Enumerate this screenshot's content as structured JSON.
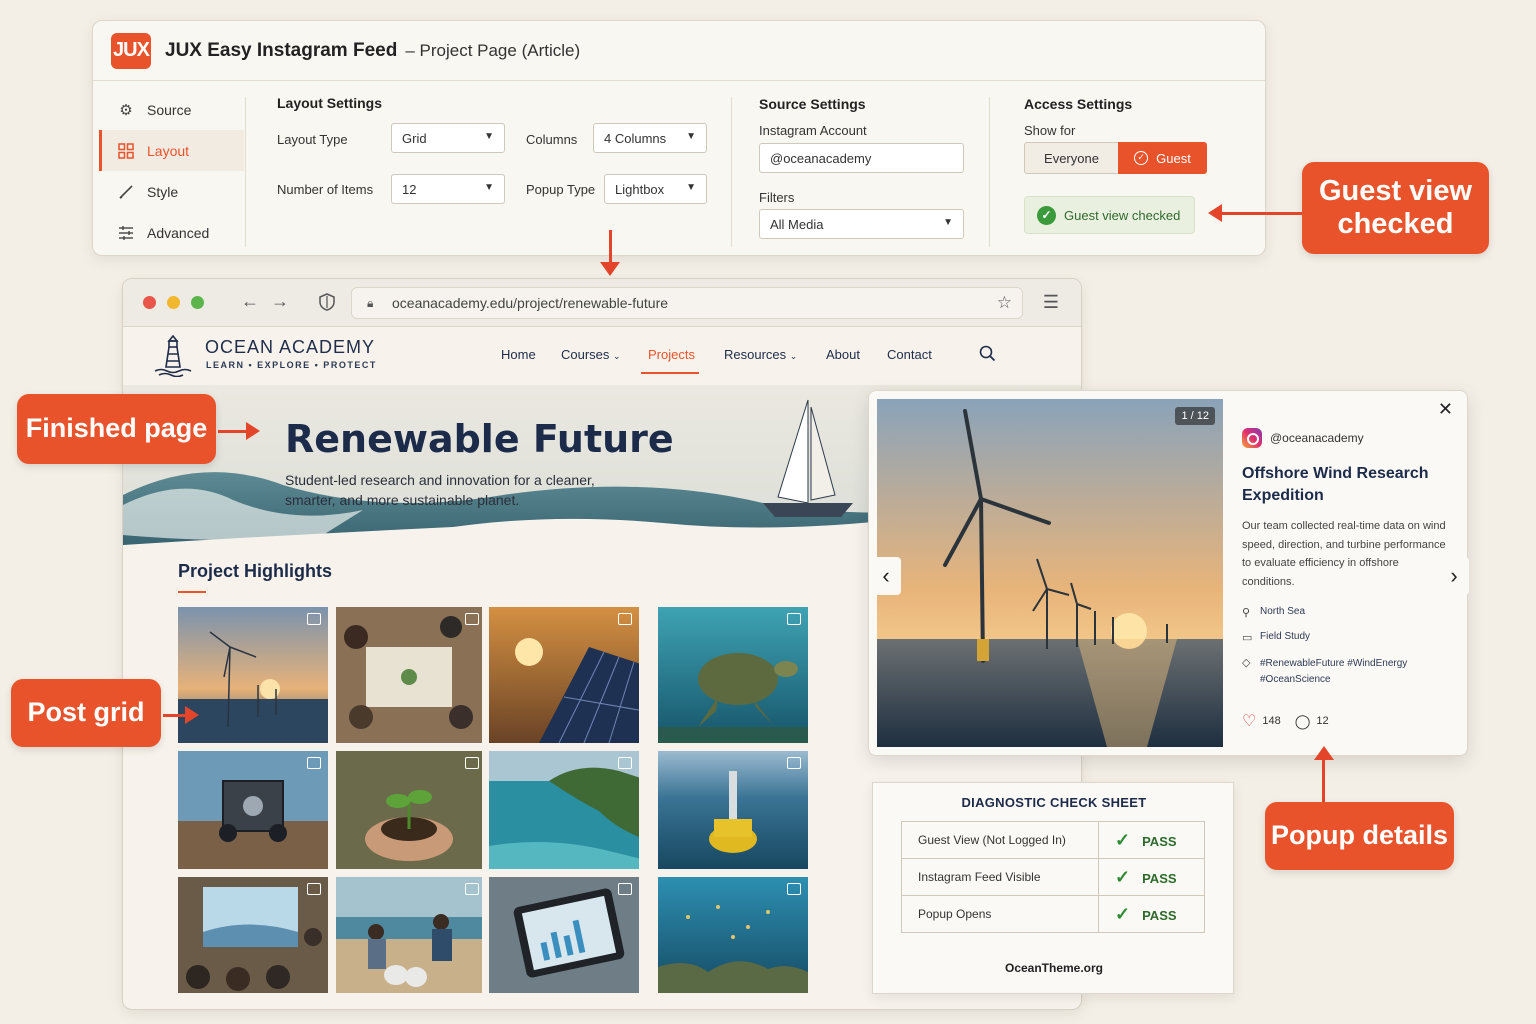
{
  "admin": {
    "logo": "JUX",
    "title": "JUX Easy Instagram Feed",
    "subtitle": "– Project Page (Article)",
    "sidebar": [
      {
        "label": "Source",
        "icon": "gear-icon"
      },
      {
        "label": "Layout",
        "icon": "grid-icon",
        "active": true
      },
      {
        "label": "Style",
        "icon": "brush-icon"
      },
      {
        "label": "Advanced",
        "icon": "sliders-icon"
      }
    ],
    "layout_settings": {
      "title": "Layout Settings",
      "layout_type_label": "Layout Type",
      "layout_type_value": "Grid",
      "columns_label": "Columns",
      "columns_value": "4 Columns",
      "items_label": "Number of Items",
      "items_value": "12",
      "popup_label": "Popup Type",
      "popup_value": "Lightbox"
    },
    "source_settings": {
      "title": "Source Settings",
      "account_label": "Instagram Account",
      "account_value": "@oceanacademy",
      "filters_label": "Filters",
      "filters_value": "All Media"
    },
    "access_settings": {
      "title": "Access Settings",
      "show_for_label": "Show for",
      "everyone": "Everyone",
      "guest": "Guest",
      "checked_text": "Guest view checked"
    }
  },
  "callouts": {
    "guest": "Guest view checked",
    "finished": "Finished page",
    "post_grid": "Post grid",
    "popup": "Popup details"
  },
  "browser": {
    "url": "oceanacademy.edu/project/renewable-future"
  },
  "site": {
    "brand": "OCEAN ACADEMY",
    "tagline": "LEARN • EXPLORE • PROTECT",
    "nav": [
      "Home",
      "Courses",
      "Projects",
      "Resources",
      "About",
      "Contact"
    ],
    "active_nav": "Projects",
    "hero_title": "Renewable Future",
    "hero_sub": "Student-led research and innovation for a cleaner, smarter, and more sustainable planet.",
    "highlights_title": "Project Highlights"
  },
  "popup": {
    "counter": "1 / 12",
    "handle": "@oceanacademy",
    "title": "Offshore Wind Research Expedition",
    "body": "Our team collected real-time data on wind speed, direction, and turbine performance to evaluate efficiency in offshore conditions.",
    "location": "North Sea",
    "category": "Field Study",
    "tags": "#RenewableFuture #WindEnergy #OceanScience",
    "likes": "148",
    "comments": "12"
  },
  "diagnostic": {
    "title": "DIAGNOSTIC CHECK SHEET",
    "rows": [
      {
        "check": "Guest View (Not Logged In)",
        "result": "PASS"
      },
      {
        "check": "Instagram Feed Visible",
        "result": "PASS"
      },
      {
        "check": "Popup Opens",
        "result": "PASS"
      }
    ],
    "footer": "OceanTheme.org"
  },
  "colors": {
    "accent": "#e8532b",
    "navy": "#1c2b4a",
    "pass": "#2f8a32"
  }
}
